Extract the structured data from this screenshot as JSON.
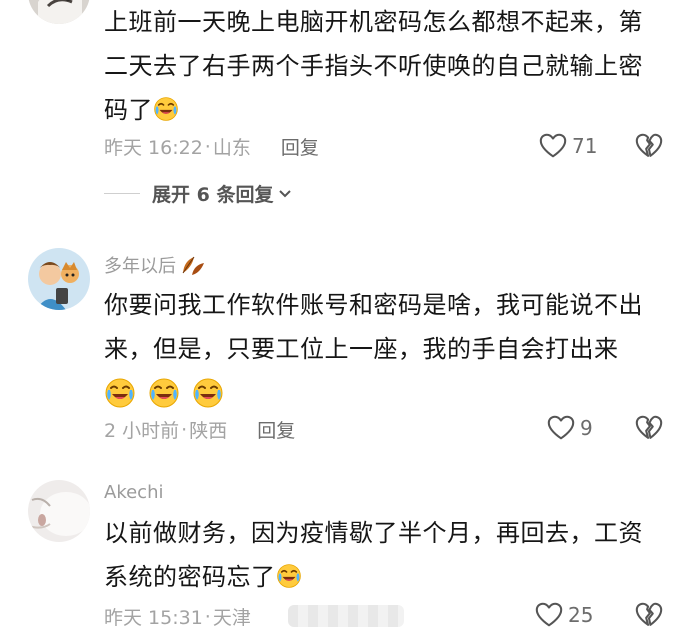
{
  "comments": [
    {
      "text_lines": [
        "上班前一天晚上电脑开机密码怎么都想不起来，第",
        "二天去了右手两个手指头不听使唤的自己就输上密",
        "码了"
      ],
      "time": "昨天 16:22",
      "location": "山东",
      "reply_label": "回复",
      "likes": "71",
      "expand_label": "展开 6 条回复"
    },
    {
      "username": "多年以后",
      "text_lines": [
        "你要问我工作软件账号和密码是啥，我可能说不出",
        "来，但是，只要工位上一座，我的手自会打出来"
      ],
      "time": "2 小时前",
      "location": "陕西",
      "reply_label": "回复",
      "likes": "9"
    },
    {
      "username": "Akechi",
      "text_lines": [
        "以前做财务，因为疫情歇了半个月，再回去，工资",
        "系统的密码忘了"
      ],
      "time": "昨天 15:31",
      "location": "天津",
      "likes": "25"
    }
  ],
  "separator": "·",
  "icons": {
    "like": "heart-outline-icon",
    "dislike": "broken-heart-icon",
    "emoji": "laughing-crying-emoji-icon",
    "chevron": "chevron-down-icon"
  },
  "colors": {
    "text": "#161616",
    "meta": "#a3a3a3",
    "emoji": "#ffc83d"
  }
}
